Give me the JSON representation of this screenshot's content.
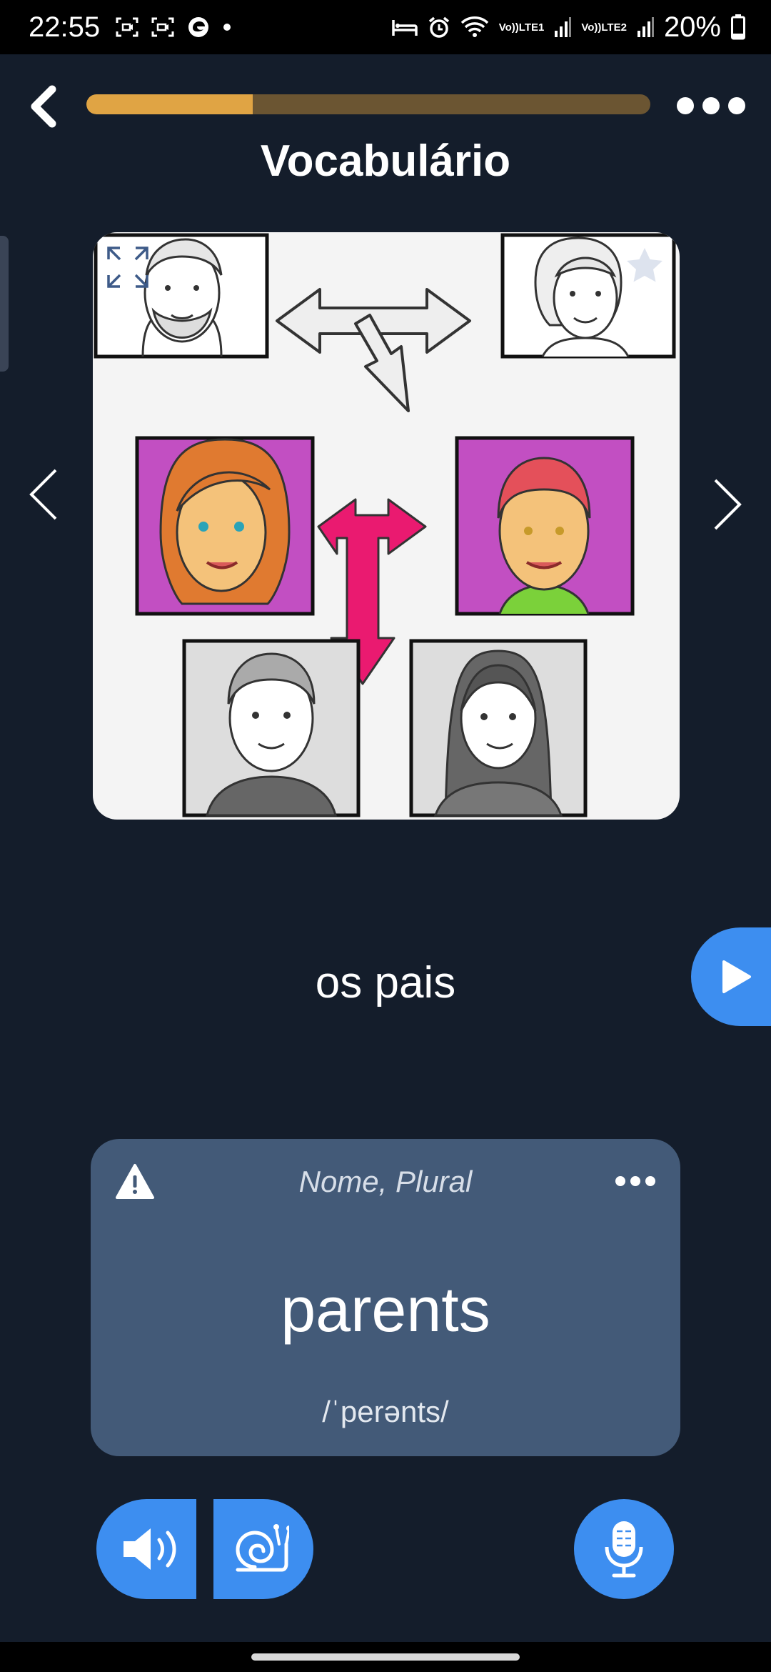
{
  "status_bar": {
    "time": "22:55",
    "lte1": "LTE1",
    "lte2": "LTE2",
    "vo": "Vo))",
    "battery": "20%"
  },
  "header": {
    "title": "Vocabulário",
    "progress_fraction": 0.295,
    "colors": {
      "progress_fill": "#e0a444",
      "progress_track": "#6b5532"
    }
  },
  "card": {
    "word": "os pais",
    "illustration": "family tree: grandparents, parents, children"
  },
  "translation": {
    "part_of_speech": "Nome, Plural",
    "word": "parents",
    "phonetic": "/ˈperənts/"
  },
  "icons": {
    "back": "chevron-left-icon",
    "more": "more-dots-icon",
    "expand": "expand-icon",
    "favorite": "star-icon",
    "prev": "chevron-left-thin-icon",
    "next": "chevron-right-thin-icon",
    "play": "play-icon",
    "warning": "warning-icon",
    "audio": "speaker-icon",
    "slow": "snail-icon",
    "mic": "microphone-icon"
  },
  "colors": {
    "accent": "#3d8ef0",
    "background": "#141d2b",
    "card": "#435a78"
  }
}
